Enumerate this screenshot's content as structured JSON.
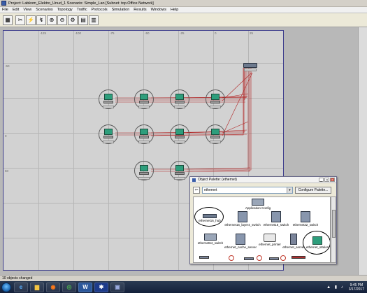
{
  "window": {
    "title": "Project: Labkom_Elektro_Unud_1 Scenario: Simple_Lan  [Subnet: top.Office Network]"
  },
  "menu": {
    "items": [
      "File",
      "Edit",
      "View",
      "Scenarios",
      "Topology",
      "Traffic",
      "Protocols",
      "Simulation",
      "Results",
      "Windows",
      "Help"
    ]
  },
  "toolbar": {
    "buttons": [
      {
        "icon": "palette-icon",
        "glyph": "▦"
      },
      {
        "icon": "cut-link-icon",
        "glyph": "✂"
      },
      {
        "icon": "failure-icon",
        "glyph": "⚡"
      },
      {
        "icon": "recover-icon",
        "glyph": "↯"
      },
      {
        "icon": "zoom-in-icon",
        "glyph": "⊕"
      },
      {
        "icon": "zoom-out-icon",
        "glyph": "⊖"
      },
      {
        "icon": "configure-sim-icon",
        "glyph": "⚙"
      },
      {
        "icon": "view-results-icon",
        "glyph": "▤"
      },
      {
        "icon": "hide-graphs-icon",
        "glyph": "▥"
      }
    ]
  },
  "canvas": {
    "ruler_top": [
      "-125",
      "-100",
      "-75",
      "-50",
      "-25",
      "0",
      "25",
      "50"
    ],
    "ruler_left": [
      "-50",
      "0",
      "50"
    ]
  },
  "palette": {
    "title": "Object Palette: (ethernet)",
    "search_value": "ethernet",
    "configure_label": "Configure Palette...",
    "items": [
      {
        "label": "",
        "type": "header"
      },
      {
        "label": "Application Config",
        "type": "config"
      },
      {
        "label": "ethernet16_hub",
        "type": "hub"
      },
      {
        "label": "ethernet16_layer4_switch",
        "type": "box"
      },
      {
        "label": "ethernet16_switch",
        "type": "box"
      },
      {
        "label": "ethernet32_switch",
        "type": "box"
      },
      {
        "label": "ethernet64_switch",
        "type": "wide"
      },
      {
        "label": "ethernet_cache_server",
        "type": "box"
      },
      {
        "label": "ethernet_printer",
        "type": "printer"
      },
      {
        "label": "ethernet_server",
        "type": "server"
      },
      {
        "label": "ethernet_station",
        "type": "station"
      }
    ]
  },
  "statusbar": {
    "text": "10 objects changed"
  },
  "taskbar": {
    "clock_time": "9:45 PM",
    "clock_date": "3/17/2017",
    "apps": [
      {
        "icon": "ie-icon",
        "glyph": "e"
      },
      {
        "icon": "explorer-icon",
        "glyph": "▆"
      },
      {
        "icon": "firefox-icon",
        "glyph": "◉"
      },
      {
        "icon": "chrome-icon",
        "glyph": "◎"
      },
      {
        "icon": "word-icon",
        "glyph": "W"
      },
      {
        "icon": "opnet-icon",
        "glyph": "✱"
      },
      {
        "icon": "app-icon",
        "glyph": "▣"
      }
    ]
  }
}
